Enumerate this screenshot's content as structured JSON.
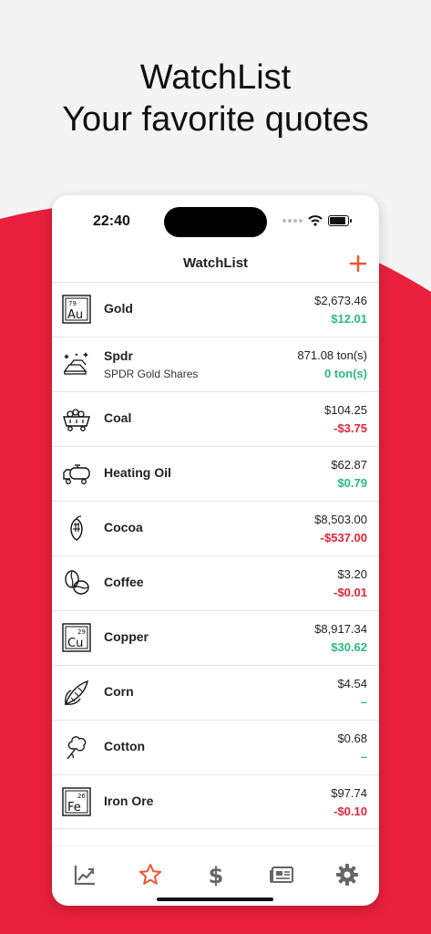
{
  "promo": {
    "line1": "WatchList",
    "line2": "Your favorite quotes",
    "accent_color": "#e8203b"
  },
  "status_bar": {
    "time": "22:40"
  },
  "nav": {
    "title": "WatchList",
    "add_icon": "plus-icon"
  },
  "rows": [
    {
      "name": "Gold",
      "price": "$2,673.46",
      "change": "$12.01",
      "icon": "gold-element-icon"
    },
    {
      "name": "Spdr",
      "subtitle": "SPDR Gold Shares",
      "price": "871.08 ton(s)",
      "change": "0 ton(s)",
      "icon": "gold-bars-icon"
    },
    {
      "name": "Coal",
      "price": "$104.25",
      "change": "-$3.75",
      "icon": "coal-cart-icon"
    },
    {
      "name": "Heating Oil",
      "price": "$62.87",
      "change": "$0.79",
      "icon": "oil-truck-icon"
    },
    {
      "name": "Cocoa",
      "price": "$8,503.00",
      "change": "-$537.00",
      "icon": "cocoa-pod-icon"
    },
    {
      "name": "Coffee",
      "price": "$3.20",
      "change": "-$0.01",
      "icon": "coffee-bean-icon"
    },
    {
      "name": "Copper",
      "price": "$8,917.34",
      "change": "$30.62",
      "icon": "copper-element-icon"
    },
    {
      "name": "Corn",
      "price": "$4.54",
      "change": "–",
      "icon": "corn-icon"
    },
    {
      "name": "Cotton",
      "price": "$0.68",
      "change": "–",
      "icon": "cotton-icon"
    },
    {
      "name": "Iron Ore",
      "price": "$97.74",
      "change": "-$0.10",
      "icon": "iron-element-icon"
    }
  ],
  "elements": {
    "gold": {
      "number": "79",
      "symbol": "Au"
    },
    "copper": {
      "number": "29",
      "symbol": "Cu"
    },
    "iron": {
      "number": "26",
      "symbol": "Fe"
    }
  },
  "tabs": [
    {
      "name": "chart-icon",
      "active": false
    },
    {
      "name": "star-icon",
      "active": true
    },
    {
      "name": "dollar-icon",
      "active": false
    },
    {
      "name": "news-icon",
      "active": false
    },
    {
      "name": "gear-icon",
      "active": false
    }
  ],
  "colors": {
    "positive": "#2dba7e",
    "negative": "#e5243b",
    "active_tab": "#f0552a"
  }
}
